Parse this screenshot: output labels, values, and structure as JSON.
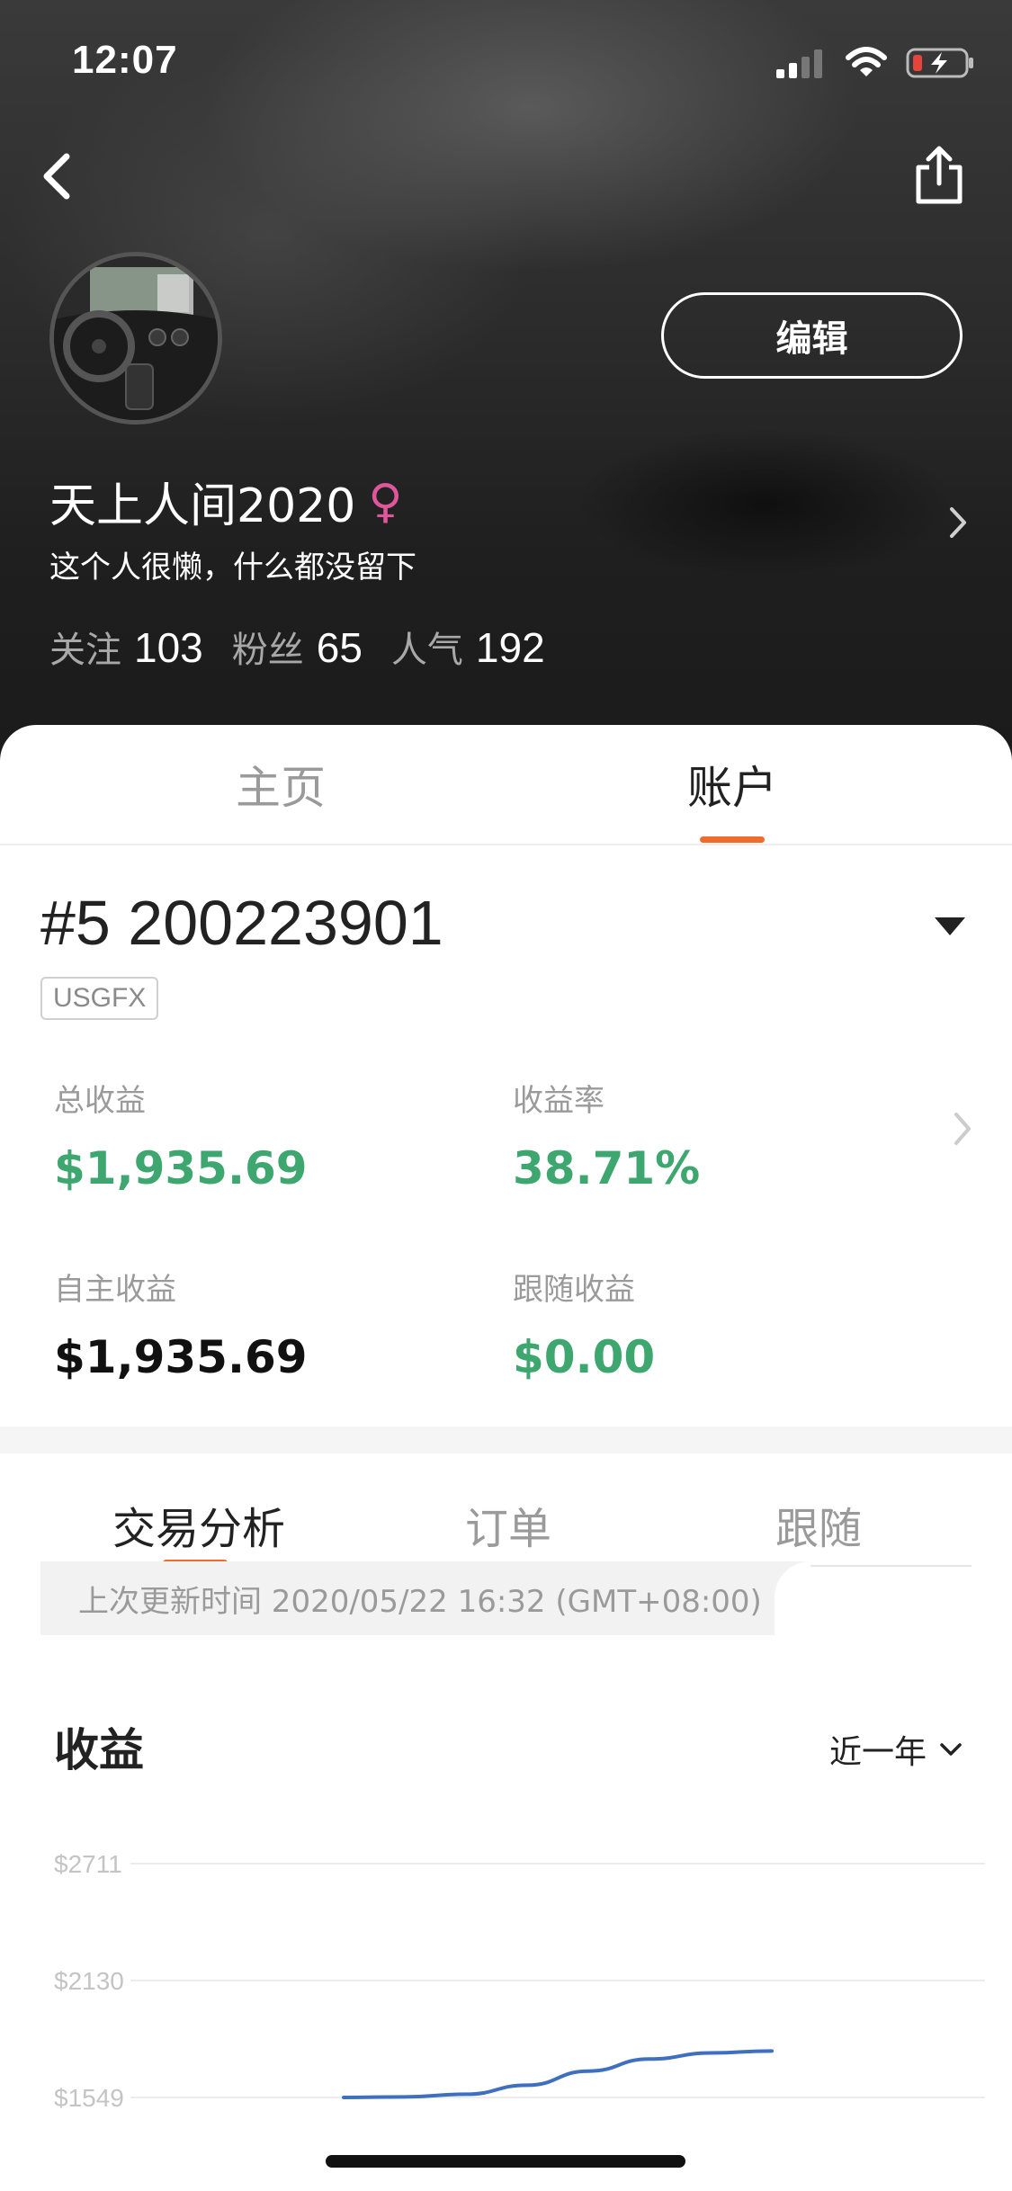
{
  "status_bar": {
    "time": "12:07"
  },
  "profile": {
    "edit_label": "编辑",
    "name": "天上人间2020",
    "gender_symbol": "♀",
    "bio": "这个人很懒，什么都没留下",
    "stats": [
      {
        "label": "关注",
        "value": "103"
      },
      {
        "label": "粉丝",
        "value": "65"
      },
      {
        "label": "人气",
        "value": "192"
      }
    ]
  },
  "main_tabs": [
    {
      "label": "主页",
      "active": false
    },
    {
      "label": "账户",
      "active": true
    }
  ],
  "account": {
    "id": "#5 200223901",
    "broker": "USGFX",
    "total_profit_label": "总收益",
    "total_profit": "$1,935.69",
    "return_rate_label": "收益率",
    "return_rate": "38.71%",
    "own_profit_label": "自主收益",
    "own_profit": "$1,935.69",
    "follow_profit_label": "跟随收益",
    "follow_profit": "$0.00"
  },
  "sub_tabs": [
    {
      "label": "交易分析",
      "active": true
    },
    {
      "label": "订单",
      "active": false
    },
    {
      "label": "跟随",
      "active": false
    }
  ],
  "update_text": "上次更新时间 2020/05/22 16:32 (GMT+08:00)",
  "profit_section": {
    "title": "收益",
    "range": "近一年"
  },
  "colors": {
    "accent": "#ef6c2e",
    "positive": "#3ea66f",
    "line": "#3f6fbf"
  },
  "chart_data": {
    "type": "line",
    "title": "",
    "ytick_labels": [
      "$2711",
      "$2130",
      "$1549"
    ],
    "ylim": [
      1549,
      2711
    ],
    "series": [
      {
        "values": [
          1549,
          1552,
          1565,
          1610,
          1680,
          1740,
          1770,
          1780
        ]
      }
    ]
  }
}
